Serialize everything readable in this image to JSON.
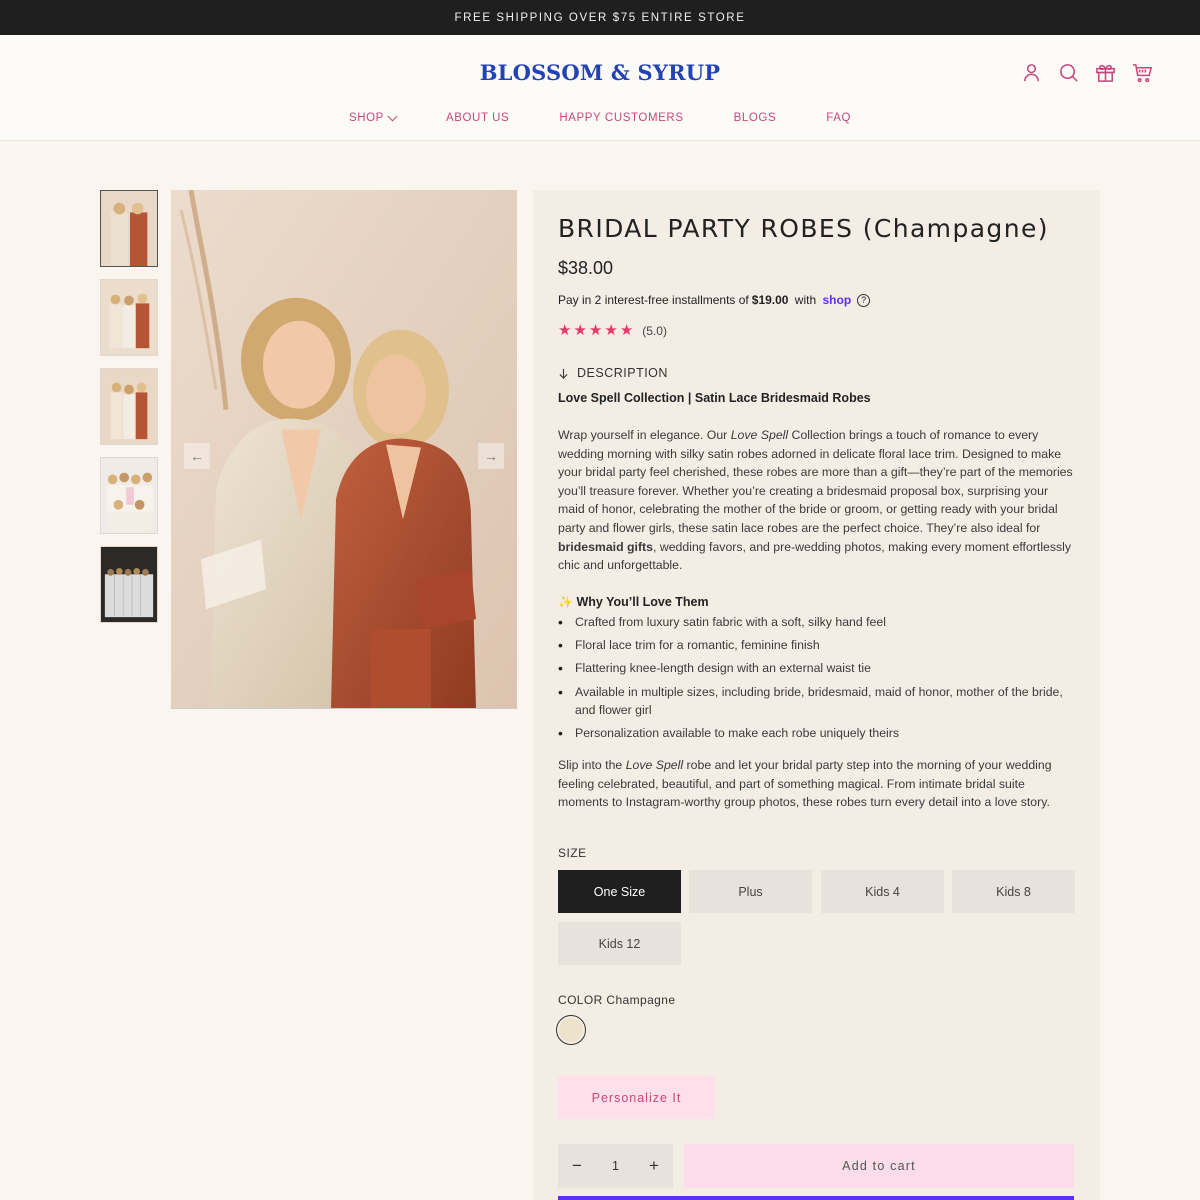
{
  "announcement": "FREE SHIPPING OVER $75 ENTIRE STORE",
  "brand": "BLOSSOM & SYRUP",
  "header_icons": [
    "account-icon",
    "search-icon",
    "gift-icon",
    "cart-icon"
  ],
  "nav": [
    {
      "label": "SHOP",
      "has_dropdown": true
    },
    {
      "label": "ABOUT US"
    },
    {
      "label": "HAPPY CUSTOMERS"
    },
    {
      "label": "BLOGS"
    },
    {
      "label": "FAQ"
    }
  ],
  "product": {
    "title": "BRIDAL PARTY ROBES (Champagne)",
    "price": "$38.00",
    "installments_text": "Pay in 2 interest-free installments of ",
    "installment_amount": "$19.00",
    "installments_with": " with ",
    "shop_word": "shop",
    "rating_value": 5,
    "rating_text": "(5.0)",
    "description_toggle": "DESCRIPTION",
    "collection_heading": "Love Spell Collection | Satin Lace Bridesmaid Robes",
    "para1": {
      "a": "Wrap yourself in elegance. Our ",
      "b": "Love Spell",
      "c": " Collection brings a touch of romance to every wedding morning with silky satin robes adorned in delicate floral lace trim. Designed to make your bridal party feel cherished, these robes are more than a gift—they’re part of the memories you’ll treasure forever. Whether you’re creating a bridesmaid proposal box, surprising your maid of honor, celebrating the mother of the bride or groom, or getting ready with your bridal party and flower girls, these satin lace robes are the perfect choice. They’re also ideal for ",
      "d": "bridesmaid gifts",
      "e": ", wedding favors, and pre-wedding photos, making every moment effortlessly chic and unforgettable."
    },
    "why_heading": "Why You’ll Love Them",
    "bullets": [
      "Crafted from luxury satin fabric with a soft, silky hand feel",
      "Floral lace trim for a romantic, feminine finish",
      "Flattering knee-length design with an external waist tie",
      "Available in multiple sizes, including bride, bridesmaid, maid of honor, mother of the bride, and flower girl",
      "Personalization available to make each robe uniquely theirs"
    ],
    "para2": {
      "a": "Slip into the ",
      "b": "Love Spell",
      "c": " robe and let your bridal party step into the morning of your wedding feeling celebrated, beautiful, and part of something magical. From intimate bridal suite moments to Instagram-worthy group photos, these robes turn every detail into a love story."
    },
    "size_label": "SIZE",
    "sizes": [
      "One Size",
      "Plus",
      "Kids 4",
      "Kids 8",
      "Kids 12"
    ],
    "selected_size": "One Size",
    "color_label": "COLOR Champagne",
    "color_swatch": "#ede3cc",
    "personalize_label": "Personalize It",
    "quantity": "1",
    "qty_minus": "−",
    "qty_plus": "+",
    "add_to_cart": "Add to cart"
  },
  "colors": {
    "accent_pink": "#c5487b",
    "brand_blue": "#2342b5",
    "star": "#e23a6a",
    "shop_pay": "#5a31f4"
  }
}
